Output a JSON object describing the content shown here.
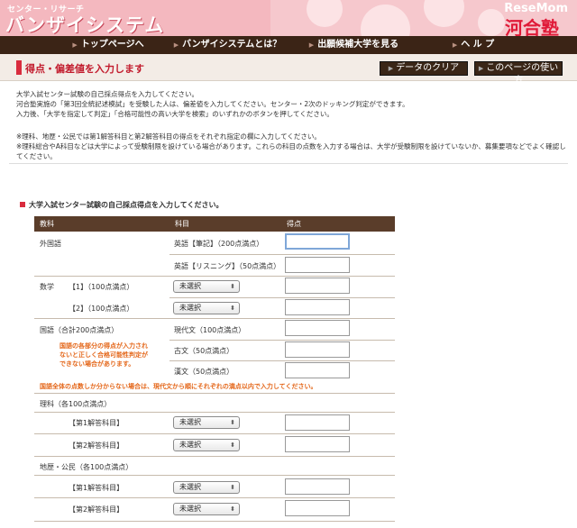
{
  "header": {
    "sub_logo": "センター・リサーチ",
    "main_logo": "バンザイシステム",
    "brand": "河合塾",
    "watermark": "ReseMom"
  },
  "nav": [
    {
      "label": "トップページへ"
    },
    {
      "label": "バンザイシステムとは？"
    },
    {
      "label": "出願候補大学を見る"
    },
    {
      "label": "ヘ ル プ"
    }
  ],
  "titlebar": {
    "title": "得点・偏差値を入力します",
    "clear_label": "データのクリア",
    "howto_label": "このページの使い方"
  },
  "intro": [
    "大学入試センター試験の自己採点得点を入力してください。",
    "河合塾実施の「第3回全統記述模試」を受験した人は、偏差値を入力してください。センター・2次のドッキング判定ができます。",
    "入力後、「大学を指定して判定」「合格可能性の高い大学を検索」のいずれかのボタンを押してください。"
  ],
  "notes": [
    "※理科、地歴・公民では第1解答科目と第2解答科目の得点をそれぞれ指定の欄に入力してください。",
    "※理科総合やA科目などは大学によって受験制限を設けている場合があります。これらの科目の点数を入力する場合は、大学が受験制限を設けていないか、募集要項などでよく確認してください。"
  ],
  "section": {
    "title": "大学入試センター試験の自己採点得点を入力してください。",
    "columns": [
      "教科",
      "科目",
      "得点"
    ],
    "foreign": {
      "label": "外国語",
      "writing": "英語【筆記】（200点満点）",
      "listening": "英語【リスニング】（50点満点）"
    },
    "math": {
      "label": "数学",
      "m1": "【1】（100点満点）",
      "m2": "【2】（100点満点）"
    },
    "japanese": {
      "label": "国語（合計200点満点）",
      "modern": "現代文（100点満点）",
      "classic": "古文（50点満点）",
      "kanbun": "漢文（50点満点）",
      "warning": "国語の各部分の得点が入力されないと正しく合格可能性判定ができない場合があります。",
      "warning_total": "国語全体の点数しか分からない場合は、現代文から順にそれぞれの満点以内で入力してください。"
    },
    "science": {
      "label": "理科（各100点満点）",
      "first": "【第1解答科目】",
      "second": "【第2解答科目】"
    },
    "social": {
      "label": "地歴・公民（各100点満点）",
      "first": "【第1解答科目】",
      "second": "【第2解答科目】"
    },
    "select_default": "未選択"
  }
}
